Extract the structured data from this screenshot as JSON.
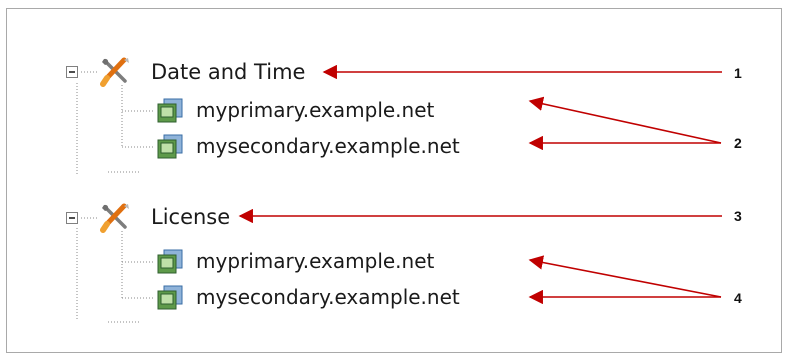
{
  "tree": {
    "groups": [
      {
        "label": "Date and Time",
        "icon": "tools-icon",
        "expanded": true,
        "children": [
          {
            "label": "myprimary.example.net",
            "icon": "server-icon"
          },
          {
            "label": "mysecondary.example.net",
            "icon": "server-icon"
          }
        ]
      },
      {
        "label": "License",
        "icon": "tools-icon",
        "expanded": true,
        "children": [
          {
            "label": "myprimary.example.net",
            "icon": "server-icon"
          },
          {
            "label": "mysecondary.example.net",
            "icon": "server-icon"
          }
        ]
      }
    ]
  },
  "callouts": [
    "1",
    "2",
    "3",
    "4"
  ],
  "colors": {
    "arrow": "#c00000",
    "tree_line": "#8a8a8a",
    "border": "#a9a9a9"
  }
}
